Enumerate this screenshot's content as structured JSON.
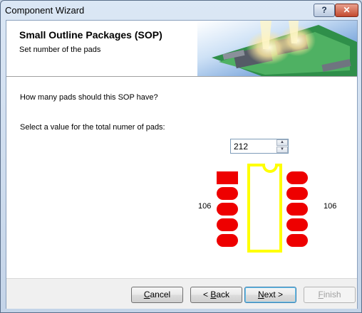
{
  "window": {
    "title": "Component Wizard",
    "help_label": "?",
    "close_label": "✕"
  },
  "header": {
    "title": "Small Outline Packages (SOP)",
    "subtitle": "Set number of the pads"
  },
  "body": {
    "question": "How many pads should this SOP have?",
    "select_label": "Select a value for the total numer of pads:",
    "pad_count": "212",
    "left_count": "106",
    "right_count": "106"
  },
  "buttons": {
    "cancel": {
      "mnemonic": "C",
      "rest": "ancel"
    },
    "back": {
      "prefix": "< ",
      "mnemonic": "B",
      "rest": "ack"
    },
    "next": {
      "mnemonic": "N",
      "rest": "ext >"
    },
    "finish": {
      "mnemonic": "F",
      "rest": "inish"
    }
  },
  "colors": {
    "pad_red": "#ee0000",
    "outline_yellow": "#ffff00"
  }
}
